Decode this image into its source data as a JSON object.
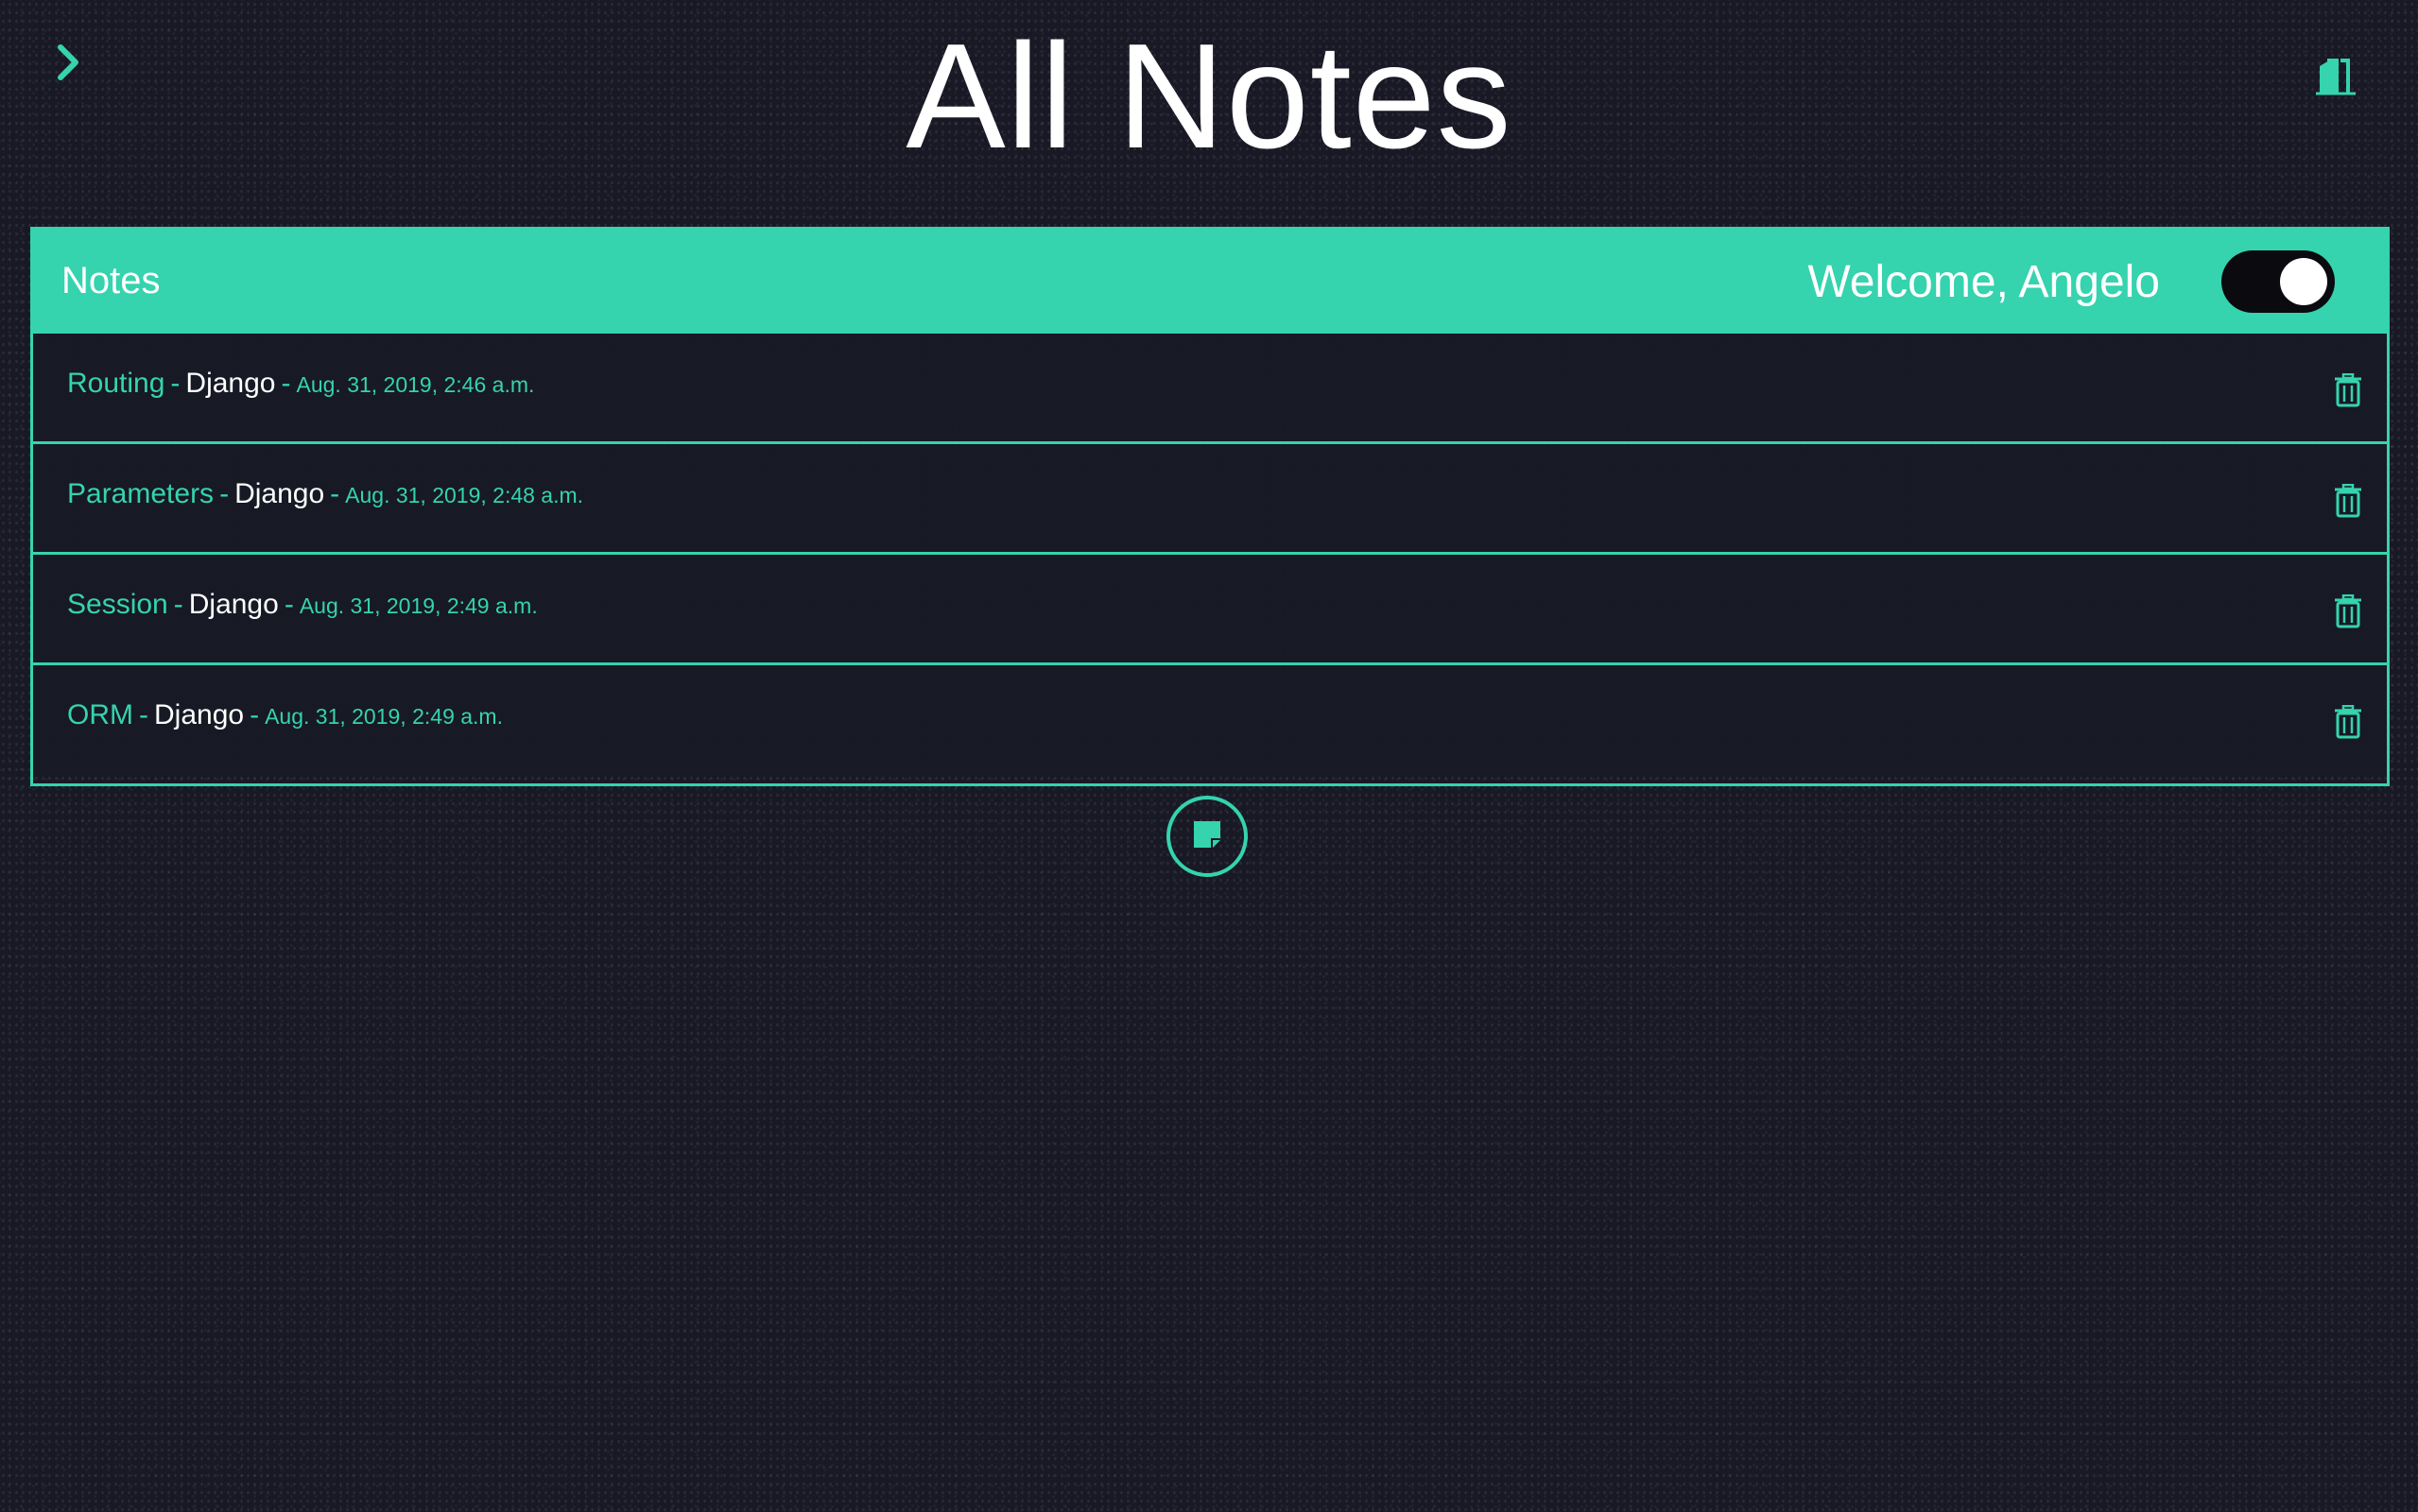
{
  "header": {
    "title": "All Notes"
  },
  "icons": {
    "menu": "chevron-right-icon",
    "logout": "door-exit-icon",
    "delete": "trash-icon",
    "add": "note-add-icon"
  },
  "panel": {
    "title": "Notes",
    "welcome": "Welcome, Angelo",
    "theme_toggle_on": true
  },
  "notes": [
    {
      "title": "Routing",
      "category": "Django",
      "date": "Aug. 31, 2019, 2:46 a.m."
    },
    {
      "title": "Parameters",
      "category": "Django",
      "date": "Aug. 31, 2019, 2:48 a.m."
    },
    {
      "title": "Session",
      "category": "Django",
      "date": "Aug. 31, 2019, 2:49 a.m."
    },
    {
      "title": "ORM",
      "category": "Django",
      "date": "Aug. 31, 2019, 2:49 a.m."
    }
  ],
  "separator": "-",
  "colors": {
    "accent": "#35d3ae",
    "background": "#181925",
    "toggle_track": "#0a0a0f",
    "text": "#ffffff"
  }
}
